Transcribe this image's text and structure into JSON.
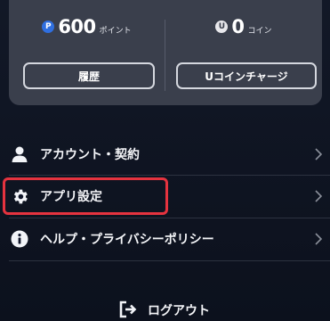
{
  "balances": {
    "points": {
      "badge": "P",
      "amount": "600",
      "unit": "ポイント"
    },
    "coins": {
      "badge": "U",
      "amount": "0",
      "unit": "コイン"
    }
  },
  "buttons": {
    "history": "履歴",
    "coin_charge": "Uコインチャージ"
  },
  "menu": {
    "items": [
      {
        "label": "アカウント・契約",
        "icon": "person-icon"
      },
      {
        "label": "アプリ設定",
        "icon": "gear-icon",
        "highlighted": true
      },
      {
        "label": "ヘルプ・プライバシーポリシー",
        "icon": "info-icon"
      }
    ],
    "logout": {
      "label": "ログアウト",
      "icon": "logout-icon"
    }
  },
  "colors": {
    "background": "#0d1220",
    "card": "#3a3f4c",
    "points_badge": "#2f6fe0",
    "highlight_border": "#e5333f"
  }
}
